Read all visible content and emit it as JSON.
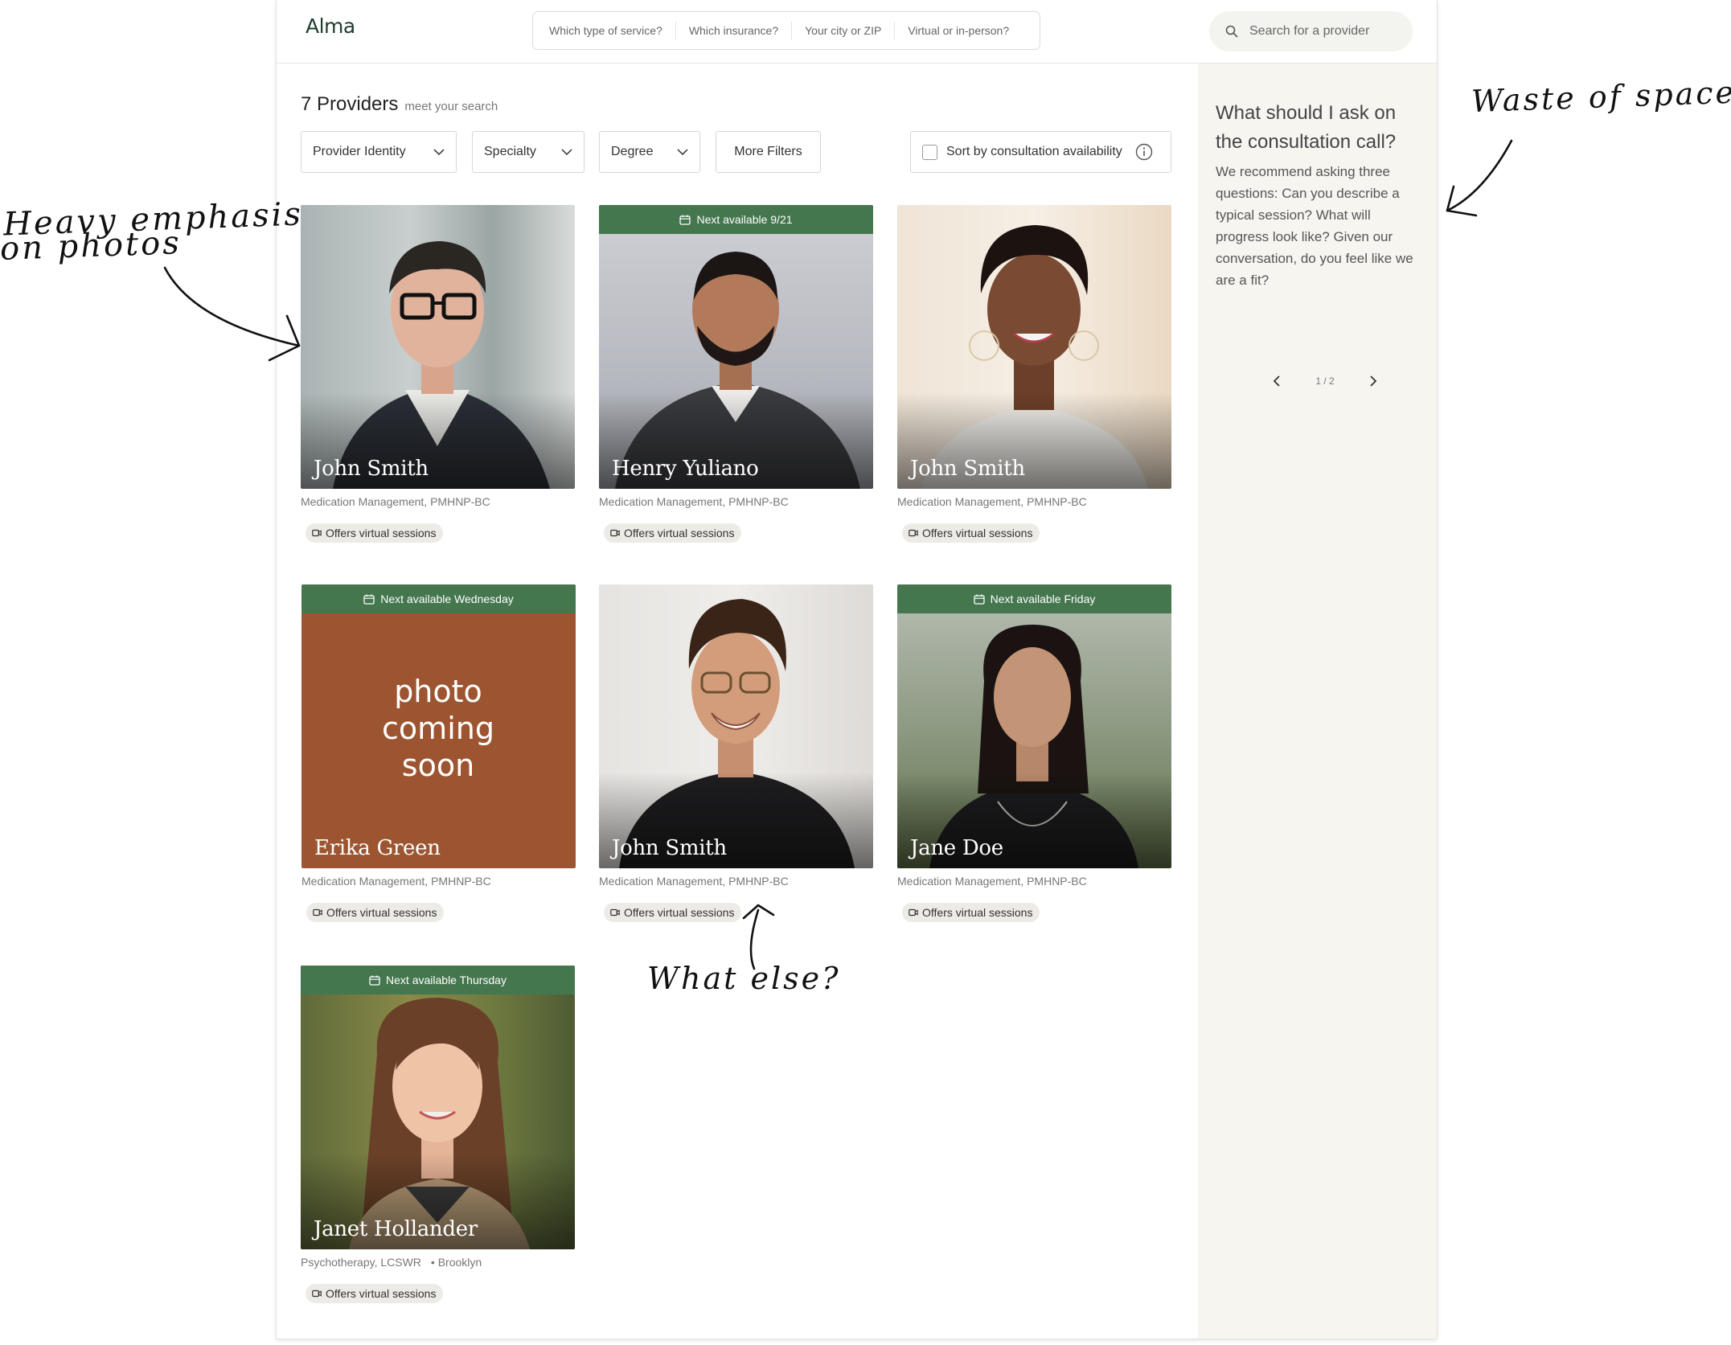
{
  "header": {
    "logo": "Alma",
    "service_search": [
      "Which type of service?",
      "Which insurance?",
      "Your city or ZIP",
      "Virtual or in-person?"
    ],
    "provider_search_placeholder": "Search for a provider"
  },
  "results": {
    "count_label": "7 Providers",
    "subtitle": "meet your search"
  },
  "filters": {
    "identity": "Provider Identity",
    "specialty": "Specialty",
    "degree": "Degree",
    "more": "More Filters",
    "sort": "Sort by consultation availability"
  },
  "providers": [
    {
      "name": "John Smith",
      "meta": "Medication Management, PMHNP-BC",
      "badge": "Offers virtual sessions",
      "availability": ""
    },
    {
      "name": "Henry Yuliano",
      "meta": "Medication Management, PMHNP-BC",
      "badge": "Offers virtual sessions",
      "availability": "Next available 9/21"
    },
    {
      "name": "John Smith",
      "meta": "Medication Management, PMHNP-BC",
      "badge": "Offers virtual sessions",
      "availability": ""
    },
    {
      "name": "Erika Green",
      "meta": "Medication Management, PMHNP-BC",
      "badge": "Offers virtual sessions",
      "availability": "Next available Wednesday",
      "placeholder": "photo coming soon"
    },
    {
      "name": "John Smith",
      "meta": "Medication Management, PMHNP-BC",
      "badge": "Offers virtual sessions",
      "availability": ""
    },
    {
      "name": "Jane Doe",
      "meta": "Medication Management, PMHNP-BC",
      "badge": "Offers virtual sessions",
      "availability": "Next available Friday"
    },
    {
      "name": "Janet Hollander",
      "meta": "Psychotherapy, LCSWR",
      "location": "• Brooklyn",
      "badge": "Offers virtual sessions",
      "availability": "Next available Thursday"
    }
  ],
  "side_panel": {
    "question": "What should I ask on the consultation call?",
    "answer": "We recommend asking three questions: Can you describe a typical session? What will progress look like? Given our conversation, do you feel like we are a fit?",
    "pager": "1 / 2"
  },
  "annotations": {
    "heavy_line1": "Heavy emphasis",
    "heavy_line2": "on photos",
    "waste": "Waste of space?",
    "what_else": "What else?"
  },
  "colors": {
    "availability_banner": "#45774f",
    "placeholder_photo": "#9c5530",
    "side_panel": "#f6f5f0",
    "logo": "#1f3d2e"
  }
}
